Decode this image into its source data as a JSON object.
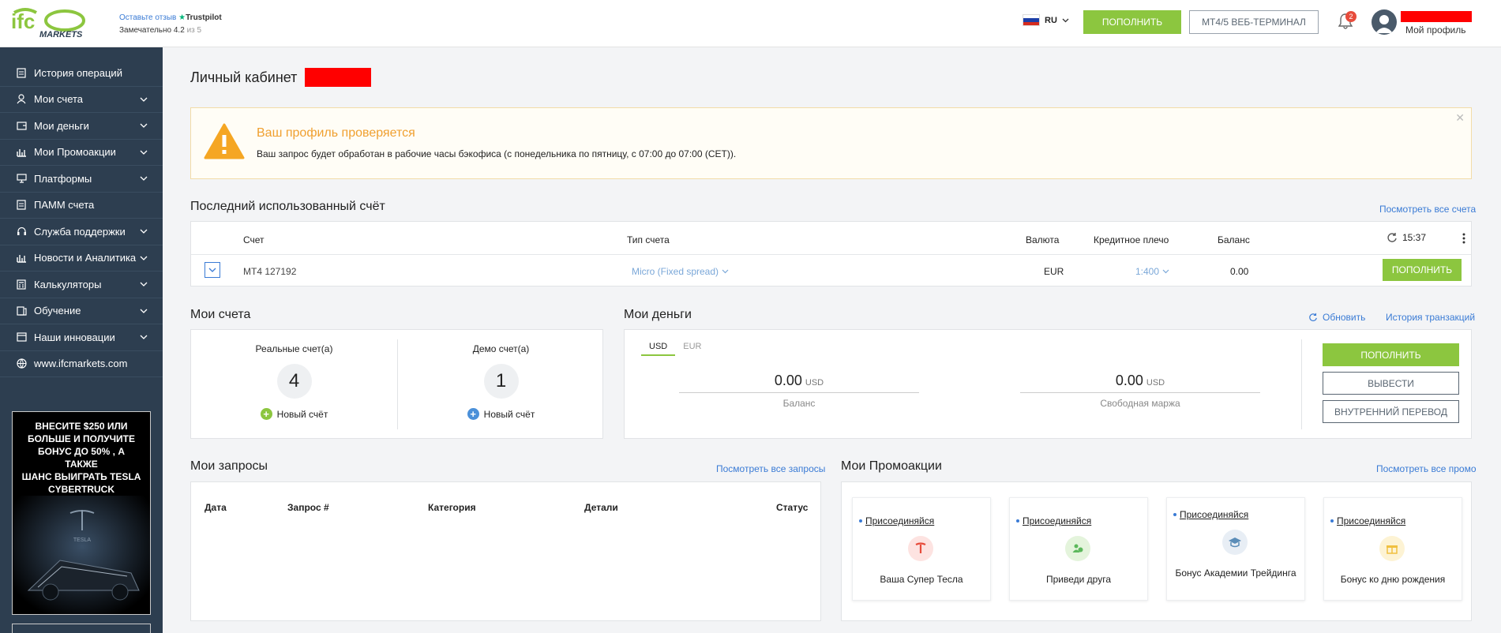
{
  "header": {
    "logo_text": "MARKETS",
    "trust_leave": "Оставьте отзыв",
    "trust_brand": "Trustpilot",
    "trust_rating_word": "Замечательно",
    "trust_rating": "4.2",
    "trust_of": "из",
    "trust_max": "5",
    "language": "RU",
    "deposit_label": "ПОПОЛНИТЬ",
    "terminal_label": "MT4/5 ВЕБ-ТЕРМИНАЛ",
    "notifications_count": "2",
    "profile_label": "Мой профиль"
  },
  "sidebar": {
    "items": [
      {
        "label": "История операций",
        "icon": "document-icon"
      },
      {
        "label": "Мои счета",
        "icon": "user-icon"
      },
      {
        "label": "Мои деньги",
        "icon": "wallet-icon"
      },
      {
        "label": "Мои Промоакции",
        "icon": "bar-chart-icon"
      },
      {
        "label": "Платформы",
        "icon": "monitor-icon"
      },
      {
        "label": "ПАММ счета",
        "icon": "document-icon"
      },
      {
        "label": "Служба поддержки",
        "icon": "support-icon"
      },
      {
        "label": "Новости и Аналитика",
        "icon": "bar-chart-icon"
      },
      {
        "label": "Калькуляторы",
        "icon": "calculator-icon"
      },
      {
        "label": "Обучение",
        "icon": "education-icon"
      },
      {
        "label": "Наши инновации",
        "icon": "innovation-icon"
      },
      {
        "label": "www.ifcmarkets.com",
        "icon": "globe-icon"
      }
    ],
    "banner_line1": "ВНЕСИТЕ $250 ИЛИ",
    "banner_line2": "БОЛЬШЕ И ПОЛУЧИТЕ",
    "banner_line3": "БОНУС ДО 50% , А ТАКЖЕ",
    "banner_line4": "ШАНС ВЫИГРАТЬ TESLA",
    "banner_line5": "CYBERTRUCK",
    "banner_brand": "TESLA"
  },
  "main": {
    "title": "Личный кабинет",
    "alert": {
      "title": "Ваш профиль проверяется",
      "text": "Ваш запрос будет обработан в рабочие часы бэкофиса (с понедельника по пятницу, с 07:00 до 07:00 (CET))."
    },
    "last_account": {
      "title": "Последний использованный счёт",
      "view_all": "Посмотреть все счета",
      "columns": [
        "Счет",
        "Тип счета",
        "Валюта",
        "Кредитное плечо",
        "Баланс"
      ],
      "time": "15:37",
      "row": {
        "account": "MT4 127192",
        "type": "Micro (Fixed spread)",
        "currency": "EUR",
        "leverage": "1:400",
        "balance": "0.00"
      },
      "deposit_label": "ПОПОЛНИТЬ"
    },
    "my_accounts": {
      "title": "Мои счета",
      "real_label": "Реальные счет(а)",
      "real_count": "4",
      "demo_label": "Демо счет(а)",
      "demo_count": "1",
      "new_account": "Новый счёт"
    },
    "my_money": {
      "title": "Мои деньги",
      "refresh": "Обновить",
      "history": "История транзакций",
      "tabs": [
        "USD",
        "EUR"
      ],
      "balance_value": "0.00",
      "balance_currency": "USD",
      "balance_label": "Баланс",
      "margin_value": "0.00",
      "margin_currency": "USD",
      "margin_label": "Свободная маржа",
      "deposit": "ПОПОЛНИТЬ",
      "withdraw": "ВЫВЕСТИ",
      "transfer": "ВНУТРЕННИЙ ПЕРЕВОД"
    },
    "requests": {
      "title": "Мои запросы",
      "view_all": "Посмотреть все запросы",
      "columns": [
        "Дата",
        "Запрос #",
        "Категория",
        "Детали",
        "Статус"
      ]
    },
    "promos": {
      "title": "Мои Промоакции",
      "view_all": "Посмотреть все промо",
      "join": "Присоединяйся",
      "cards": [
        {
          "name": "Ваша Супер Тесла",
          "icon": "tesla-icon",
          "color": "#e74c3c"
        },
        {
          "name": "Приведи друга",
          "icon": "friends-icon",
          "color": "#5cb85c"
        },
        {
          "name": "Бонус Академии Трейдинга",
          "icon": "graduation-cap-icon",
          "color": "#5b8db8"
        },
        {
          "name": "Бонус ко дню рождения",
          "icon": "gift-icon",
          "color": "#f0c040"
        }
      ]
    }
  },
  "colors": {
    "accent": "#8cc63f",
    "sidebar": "#2d3e50",
    "link": "#3a7bd5",
    "warning": "#f0a030"
  }
}
